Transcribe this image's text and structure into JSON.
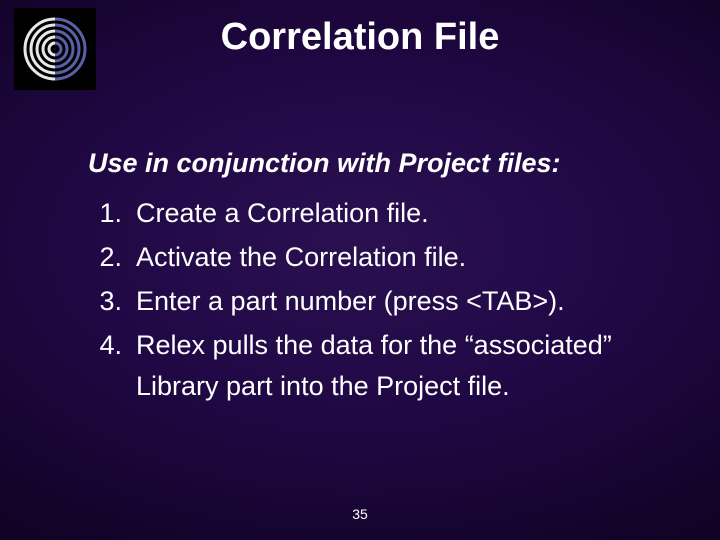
{
  "title": "Correlation File",
  "lead": "Use in conjunction with Project files:",
  "steps": [
    "Create a Correlation file.",
    "Activate the Correlation file.",
    "Enter a part number (press <TAB>).",
    "Relex pulls the data for the “associated” Library part into the Project file."
  ],
  "page_number": "35"
}
